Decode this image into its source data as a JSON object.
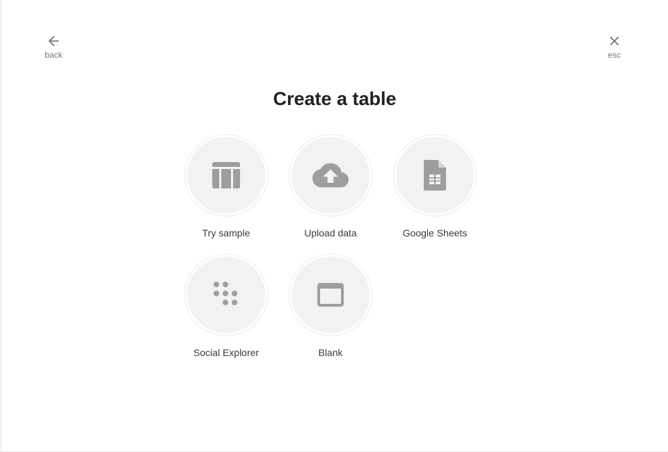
{
  "nav": {
    "back_label": "back",
    "esc_label": "esc"
  },
  "title": "Create a table",
  "options": [
    {
      "label": "Try sample",
      "icon": "table-icon"
    },
    {
      "label": "Upload data",
      "icon": "cloud-upload-icon"
    },
    {
      "label": "Google Sheets",
      "icon": "google-sheets-icon"
    },
    {
      "label": "Social Explorer",
      "icon": "dots-grid-icon"
    },
    {
      "label": "Blank",
      "icon": "blank-window-icon"
    }
  ],
  "colors": {
    "icon": "#9e9e9e",
    "circle_bg": "#f2f2f2",
    "title": "#212121",
    "label": "#3a3a3a",
    "nav": "#757575"
  }
}
